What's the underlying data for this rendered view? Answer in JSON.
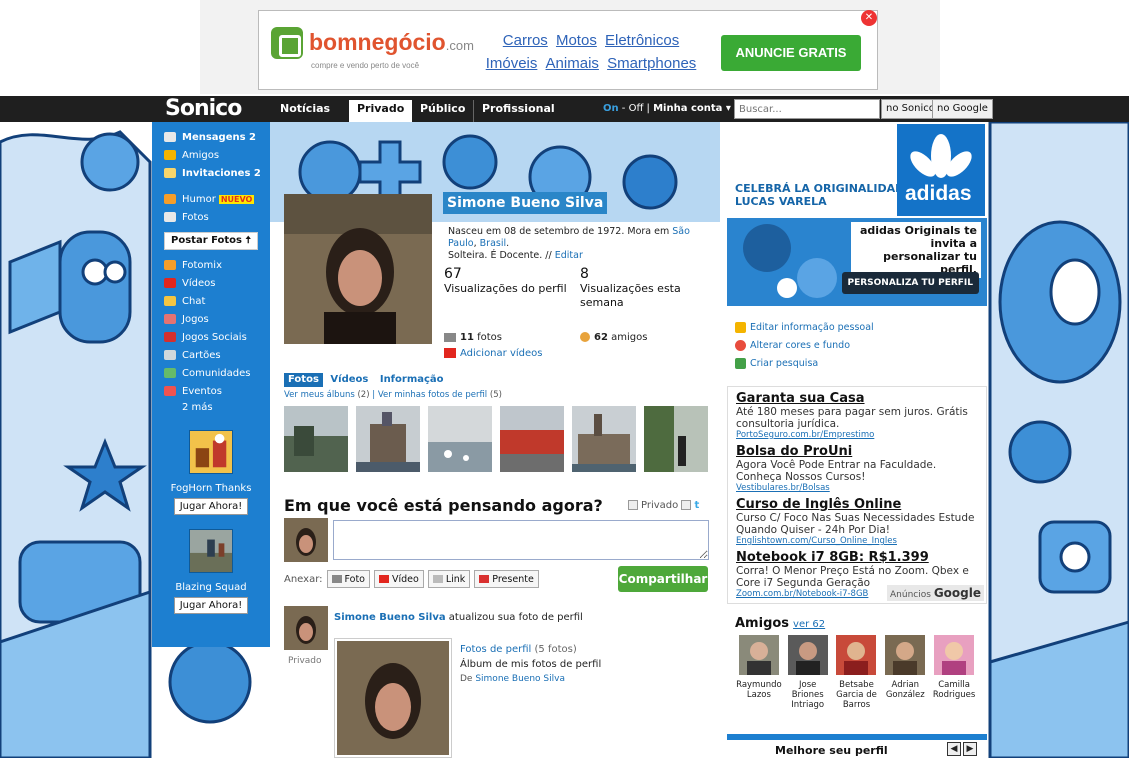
{
  "ad_banner": {
    "brand": "bomnegócio",
    "brand_suffix": ".com",
    "tagline": "compre e vendo perto de você",
    "categories_row1": [
      "Carros",
      "Motos",
      "Eletrônicos"
    ],
    "categories_row2": [
      "Imóveis",
      "Animais",
      "Smartphones"
    ],
    "cta": "ANUNCIE GRATIS"
  },
  "navbar": {
    "logo": "Sonico",
    "tabs": [
      "Notícias",
      "Privado",
      "Público",
      "Profissional"
    ],
    "active_tab": "Privado",
    "status_on": "On",
    "status_off": "Off",
    "account": "Minha conta ▾",
    "search_placeholder": "Buscar...",
    "search_sonico": "no Sonico",
    "search_google": "no Google"
  },
  "sidebar": {
    "items": [
      {
        "label": "Mensagens 2",
        "bold": true
      },
      {
        "label": "Amigos",
        "bold": false
      },
      {
        "label": "Invitaciones 2",
        "bold": true
      },
      {
        "label": "Humor",
        "bold": false,
        "badge": "NUEVO"
      },
      {
        "label": "Fotos",
        "bold": false
      }
    ],
    "postar_fotos": "Postar Fotos 🠅",
    "items2": [
      "Fotomix",
      "Vídeos",
      "Chat",
      "Jogos",
      "Jogos Sociais",
      "Cartões",
      "Comunidades",
      "Eventos"
    ],
    "more": "2 más",
    "games": [
      {
        "title": "FogHorn Thanks",
        "button": "Jugar Ahora!"
      },
      {
        "title": "Blazing Squad",
        "button": "Jugar Ahora!"
      }
    ]
  },
  "profile": {
    "name": "Simone Bueno Silva",
    "info_prefix": "Nasceu em 08 de setembro de 1972. Mora em ",
    "city": "São Paulo",
    "country": "Brasil",
    "info_rest": "Solteira. É Docente. // ",
    "edit": "Editar",
    "views_total": "67",
    "views_total_label": "Visualizações do perfil",
    "views_week": "8",
    "views_week_label": "Visualizações esta semana",
    "photos_count": "11",
    "photos_label": "fotos",
    "friends_count": "62",
    "friends_label": "amigos",
    "add_videos": "Adicionar vídeos",
    "tabs": [
      "Fotos",
      "Vídeos",
      "Informação"
    ],
    "albums_link": "Ver meus álbuns",
    "albums_count": "(2)",
    "profile_photos_link": "Ver minhas fotos de perfil",
    "profile_photos_count": "(5)"
  },
  "status": {
    "question": "Em que você está pensando agora?",
    "private_label": "Privado",
    "anexar": "Anexar:",
    "attach": [
      "Foto",
      "Vídeo",
      "Link",
      "Presente"
    ],
    "share": "Compartilhar"
  },
  "feed": {
    "who": "Simone Bueno Silva",
    "action": " atualizou sua foto de perfil",
    "privacy": "Privado",
    "album_link": "Fotos de perfil",
    "album_count": " (5 fotos)",
    "album_desc": "Álbum de mis fotos de perfil",
    "by_prefix": "De ",
    "by": "Simone Bueno Silva"
  },
  "right": {
    "adidas_slogan1": "CELEBRÁ LA ORIGINALIDAD",
    "adidas_slogan2": "LUCAS VARELA",
    "adidas_word": "adidas",
    "promo_text": "adidas Originals te invita a personalizar tu perfil.",
    "promo_btn": "PERSONALIZA TU PERFIL",
    "edit_links": [
      "Editar informação pessoal",
      "Alterar cores e fundo",
      "Criar pesquisa"
    ],
    "ads": [
      {
        "title": "Garanta sua Casa",
        "body": "Até 180 meses para pagar sem juros. Grátis consultoria jurídica.",
        "url": "PortoSeguro.com.br/Emprestimo"
      },
      {
        "title": "Bolsa do ProUni",
        "body": "Agora Você Pode Entrar na Faculdade. Conheça Nossos Cursos!",
        "url": "Vestibulares.br/Bolsas"
      },
      {
        "title": "Curso de Inglês Online",
        "body": "Curso C/ Foco Nas Suas Necessidades Estude Quando Quiser - 24h Por Dia!",
        "url": "Englishtown.com/Curso_Online_Ingles"
      },
      {
        "title": "Notebook i7 8GB: R$1.399",
        "body": "Corra! O Menor Preço Está no Zoom. Qbex e Core i7 Segunda Geração",
        "url": "Zoom.com.br/Notebook-i7-8GB"
      }
    ],
    "ads_by": "Anúncios",
    "ads_google": "Google",
    "friends_title": "Amigos",
    "friends_more": "ver 62",
    "friends": [
      {
        "name": "Raymundo Lazos"
      },
      {
        "name": "Jose Briones Intriago"
      },
      {
        "name": "Betsabe Garcia de Barros"
      },
      {
        "name": "Adrian González"
      },
      {
        "name": "Camilla Rodrigues"
      }
    ],
    "improve": "Melhore seu perfil"
  },
  "colors": {
    "sonico_blue": "#1d7fd0",
    "share_green": "#4ea83a",
    "adidas_blue": "#1473c8"
  }
}
